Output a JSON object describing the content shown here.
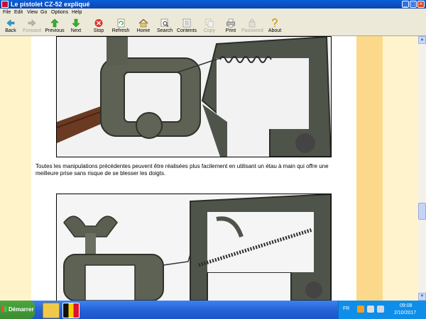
{
  "window": {
    "title": "Le pistolet CZ-52 expliqué"
  },
  "menu": [
    "File",
    "Edit",
    "View",
    "Go",
    "Options",
    "Help"
  ],
  "toolbar": [
    {
      "label": "Back",
      "icon": "back-arrow-icon",
      "enabled": true
    },
    {
      "label": "Forward",
      "icon": "forward-arrow-icon",
      "enabled": false
    },
    {
      "label": "Previous",
      "icon": "up-arrow-icon",
      "enabled": true
    },
    {
      "label": "Next",
      "icon": "down-arrow-icon",
      "enabled": true
    },
    {
      "label": "Stop",
      "icon": "stop-icon",
      "enabled": true
    },
    {
      "label": "Refresh",
      "icon": "refresh-icon",
      "enabled": true
    },
    {
      "label": "Home",
      "icon": "home-icon",
      "enabled": true
    },
    {
      "label": "Search",
      "icon": "search-icon",
      "enabled": true
    },
    {
      "label": "Contents",
      "icon": "contents-icon",
      "enabled": true
    },
    {
      "label": "Copy",
      "icon": "copy-icon",
      "enabled": false
    },
    {
      "label": "Print",
      "icon": "print-icon",
      "enabled": true
    },
    {
      "label": "Password",
      "icon": "password-icon",
      "enabled": false
    },
    {
      "label": "About",
      "icon": "about-icon",
      "enabled": true
    }
  ],
  "content": {
    "paragraph": "Toutes les manipulations précédentes peuvent être réalisées plus facilement en utilisant un étau à main qui offre une meilleure prise sans risque de se blesser les doigts."
  },
  "taskbar": {
    "start_label": "Démarrer",
    "language": "FR",
    "time": "09:08",
    "date": "2/10/2017"
  },
  "colors": {
    "titlebar": "#0b4fc2",
    "left_band": "#fff4c9",
    "right_band": "#fcd98a",
    "taskbar": "#2563d8"
  }
}
